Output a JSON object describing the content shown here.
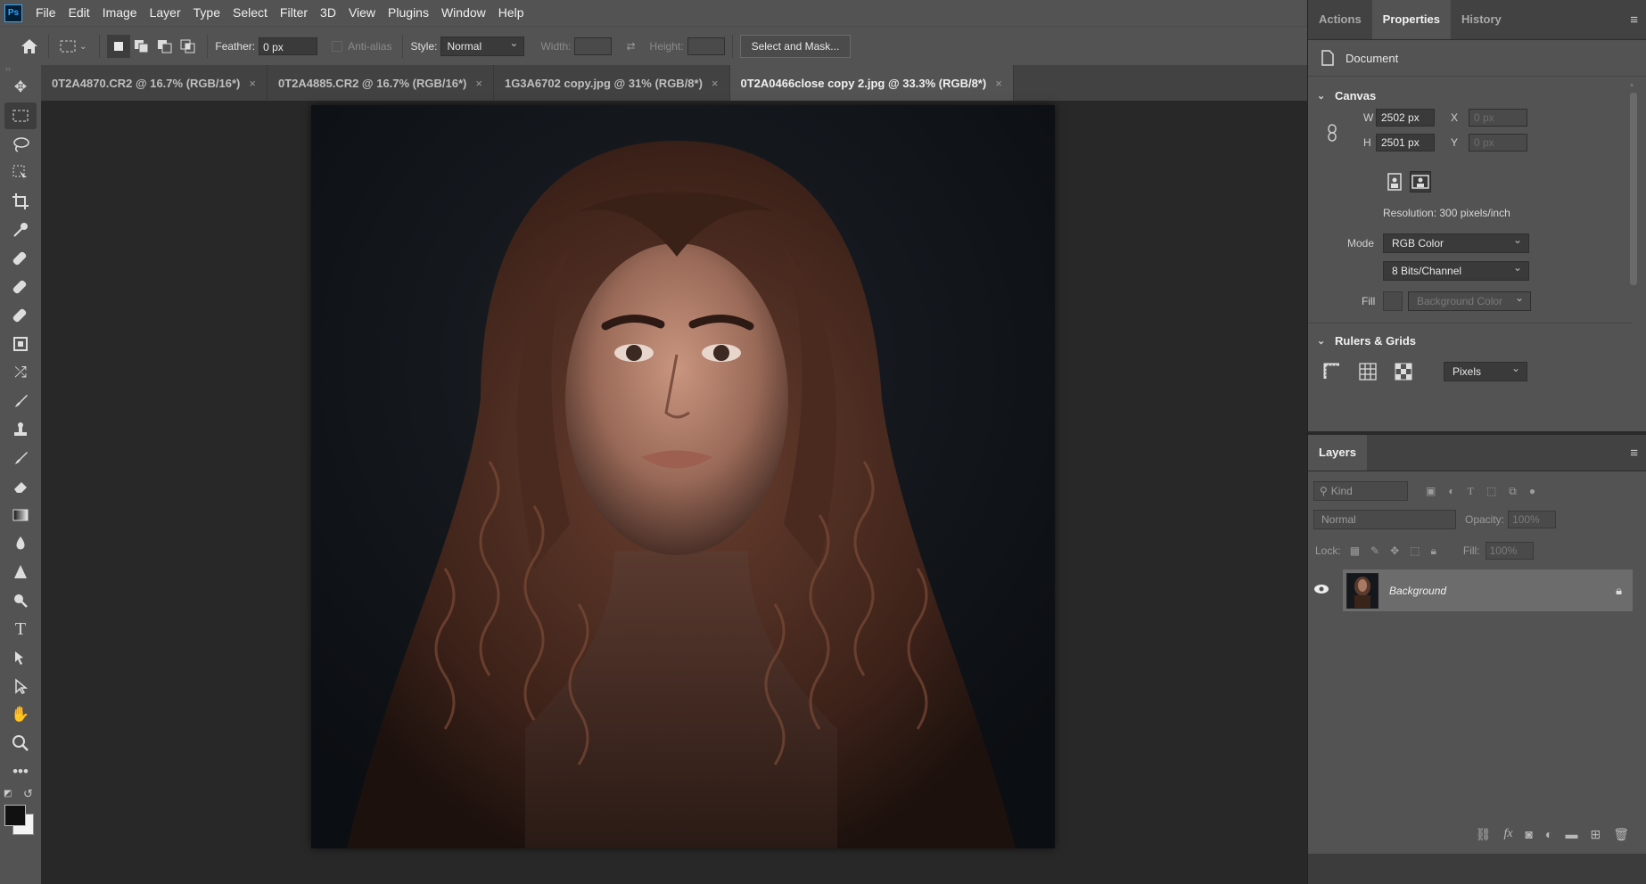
{
  "app": {
    "logo": "Ps"
  },
  "menu": [
    "File",
    "Edit",
    "Image",
    "Layer",
    "Type",
    "Select",
    "Filter",
    "3D",
    "View",
    "Plugins",
    "Window",
    "Help"
  ],
  "options": {
    "feather_label": "Feather:",
    "feather_value": "0 px",
    "anti_alias_label": "Anti-alias",
    "style_label": "Style:",
    "style_value": "Normal",
    "width_label": "Width:",
    "height_label": "Height:",
    "select_mask_button": "Select and Mask..."
  },
  "tabs": [
    {
      "label": "0T2A4870.CR2 @ 16.7% (RGB/16*)",
      "close": "×"
    },
    {
      "label": "0T2A4885.CR2 @ 16.7% (RGB/16*)",
      "close": "×"
    },
    {
      "label": "1G3A6702 copy.jpg @ 31% (RGB/8*)",
      "close": "×"
    },
    {
      "label": "0T2A0466close copy 2.jpg @ 33.3% (RGB/8*)",
      "close": "×",
      "active": true
    }
  ],
  "panel": {
    "tabs": [
      "Actions",
      "Properties",
      "History"
    ],
    "document_label": "Document",
    "canvas": {
      "heading": "Canvas",
      "w_label": "W",
      "w_value": "2502 px",
      "h_label": "H",
      "h_value": "2501 px",
      "x_label": "X",
      "x_value": "0 px",
      "y_label": "Y",
      "y_value": "0 px",
      "resolution": "Resolution: 300 pixels/inch",
      "mode_label": "Mode",
      "mode_value": "RGB Color",
      "depth_value": "8 Bits/Channel",
      "fill_label": "Fill",
      "fill_value": "Background Color"
    },
    "rulers": {
      "heading": "Rulers & Grids",
      "units_value": "Pixels"
    }
  },
  "layers": {
    "tab": "Layers",
    "kind_placeholder": "Kind",
    "blend_value": "Normal",
    "opacity_label": "Opacity:",
    "opacity_value": "100%",
    "lock_label": "Lock:",
    "fill_label": "Fill:",
    "fill_value": "100%",
    "items": [
      {
        "name": "Background"
      }
    ]
  },
  "colors": {
    "accent": "#31a8ff",
    "panel_bg": "#535353",
    "canvas_bg": "#282828"
  }
}
